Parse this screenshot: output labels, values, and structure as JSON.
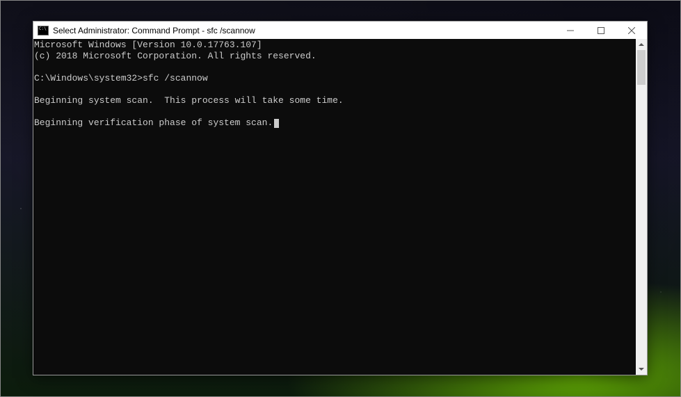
{
  "window": {
    "title": "Select Administrator: Command Prompt - sfc  /scannow"
  },
  "terminal": {
    "line1": "Microsoft Windows [Version 10.0.17763.107]",
    "line2": "(c) 2018 Microsoft Corporation. All rights reserved.",
    "prompt_path": "C:\\Windows\\system32>",
    "command": "sfc /scannow",
    "output1": "Beginning system scan.  This process will take some time.",
    "output2": "Beginning verification phase of system scan."
  }
}
